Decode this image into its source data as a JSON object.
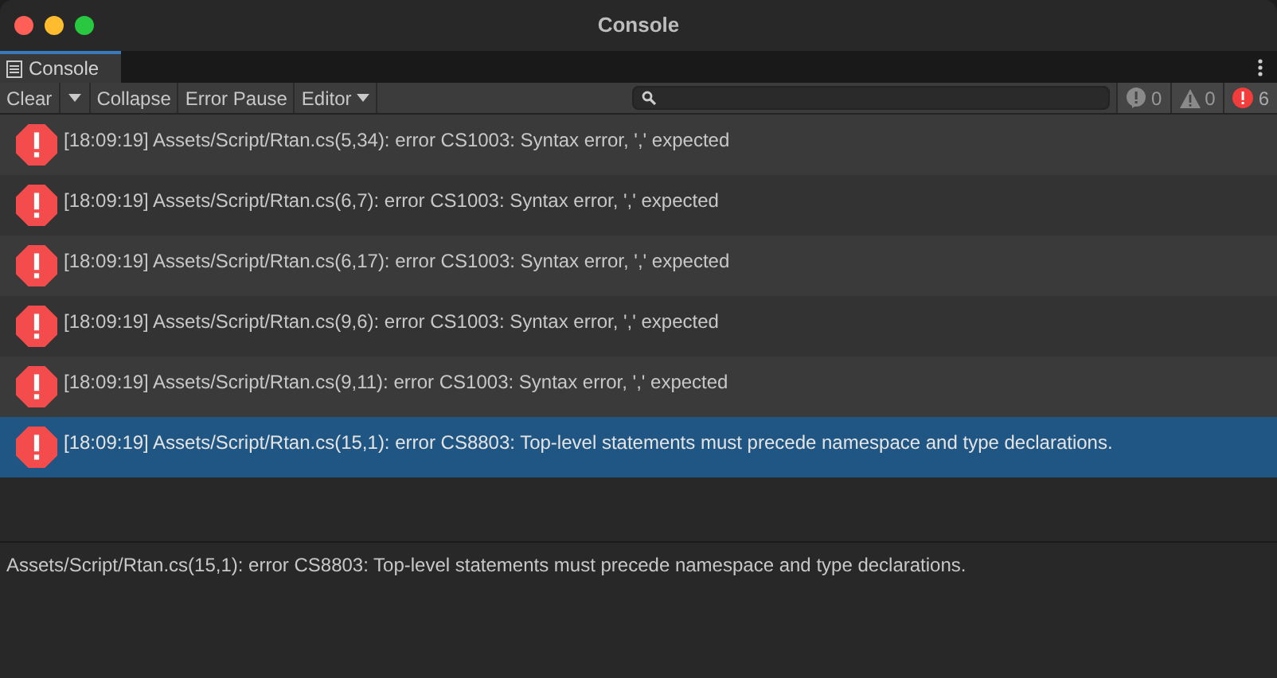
{
  "window": {
    "title": "Console"
  },
  "tabs": [
    {
      "label": "Console",
      "selected": true
    }
  ],
  "toolbar": {
    "buttons": [
      {
        "label": "Clear",
        "kind": "split"
      },
      {
        "label": "Collapse",
        "kind": "plain"
      },
      {
        "label": "Error Pause",
        "kind": "plain"
      },
      {
        "label": "Editor",
        "kind": "dropdown"
      }
    ],
    "counters": [
      {
        "kind": "info",
        "count": "0"
      },
      {
        "kind": "warning",
        "count": "0"
      },
      {
        "kind": "error",
        "count": "6"
      }
    ]
  },
  "log": [
    {
      "kind": "error",
      "text": "[18:09:19] Assets/Script/Rtan.cs(5,34): error CS1003: Syntax error, ',' expected",
      "selected": false
    },
    {
      "kind": "error",
      "text": "[18:09:19] Assets/Script/Rtan.cs(6,7): error CS1003: Syntax error, ',' expected",
      "selected": false
    },
    {
      "kind": "error",
      "text": "[18:09:19] Assets/Script/Rtan.cs(6,17): error CS1003: Syntax error, ',' expected",
      "selected": false
    },
    {
      "kind": "error",
      "text": "[18:09:19] Assets/Script/Rtan.cs(9,6): error CS1003: Syntax error, ',' expected",
      "selected": false
    },
    {
      "kind": "error",
      "text": "[18:09:19] Assets/Script/Rtan.cs(9,11): error CS1003: Syntax error, ',' expected",
      "selected": false
    },
    {
      "kind": "error",
      "text": "[18:09:19] Assets/Script/Rtan.cs(15,1): error CS8803: Top-level statements must precede namespace and type declarations.",
      "selected": true
    }
  ],
  "detail": {
    "text": "Assets/Script/Rtan.cs(15,1): error CS8803: Top-level statements must precede namespace and type declarations."
  }
}
